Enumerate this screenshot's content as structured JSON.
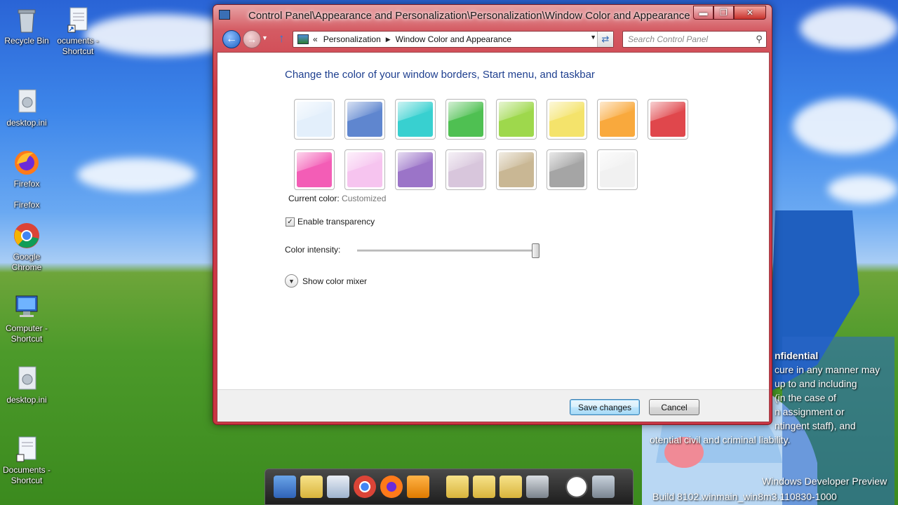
{
  "desktop": {
    "icons": [
      {
        "label": "Recycle Bin"
      },
      {
        "label": "ocuments - Shortcut"
      },
      {
        "label": "desktop.ini"
      },
      {
        "label": "Firefox"
      },
      {
        "label": "Firefox"
      },
      {
        "label": "Google Chrome"
      },
      {
        "label": "Computer - Shortcut"
      },
      {
        "label": "desktop.ini"
      },
      {
        "label": "Documents - Shortcut"
      }
    ],
    "watermark_lines": [
      "nfidential",
      "cure in any manner may",
      "up to and including",
      "(in the case of",
      "n assignment or",
      "ntingent staff), and",
      "otential civil and criminal liability."
    ],
    "dev_preview": "Windows Developer Preview",
    "build": "Build 8102.winmain_win8m3.110830-1000"
  },
  "window": {
    "title": "Control Panel\\Appearance and Personalization\\Personalization\\Window Color and Appearance",
    "caption": {
      "minimize": "▬",
      "maximize": "❐",
      "close": "✕"
    },
    "breadcrumb": {
      "prefix": "«",
      "items": [
        "Personalization",
        "Window Color and Appearance"
      ],
      "sep": "▶"
    },
    "search": {
      "placeholder": "Search Control Panel"
    },
    "heading": "Change the color of your window borders, Start menu, and taskbar",
    "swatches_row1": [
      {
        "name": "sky",
        "color": "#e3effb"
      },
      {
        "name": "twilight",
        "color": "#5f86cf"
      },
      {
        "name": "sea-foam",
        "color": "#38d0d0"
      },
      {
        "name": "leaf",
        "color": "#4fc052"
      },
      {
        "name": "lime",
        "color": "#9ed84c"
      },
      {
        "name": "sun",
        "color": "#f4e36b"
      },
      {
        "name": "pumpkin",
        "color": "#f9a93d"
      },
      {
        "name": "ruby",
        "color": "#e0474c"
      }
    ],
    "swatches_row2": [
      {
        "name": "fuchsia",
        "color": "#f35db6"
      },
      {
        "name": "blush",
        "color": "#f6c4ef"
      },
      {
        "name": "violet",
        "color": "#9b74c8"
      },
      {
        "name": "lavender",
        "color": "#d8c6dc"
      },
      {
        "name": "taupe",
        "color": "#c9b794"
      },
      {
        "name": "chocolate",
        "color": "#a5a5a5"
      },
      {
        "name": "frost",
        "color": "#f1f1f1"
      }
    ],
    "current_color_label": "Current color:",
    "current_color_value": "Customized",
    "transparency_label": "Enable transparency",
    "transparency_checked": true,
    "intensity_label": "Color intensity:",
    "intensity_value": 1.0,
    "mixer_label": "Show color mixer",
    "save_label": "Save changes",
    "cancel_label": "Cancel"
  },
  "colors": {
    "window_frame": "#cf3c48",
    "heading": "#1e3f8f"
  }
}
